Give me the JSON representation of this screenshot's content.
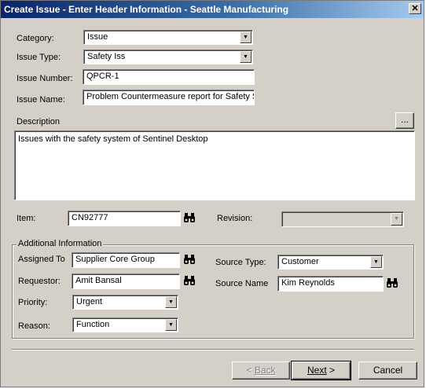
{
  "window": {
    "title": "Create Issue - Enter Header Information - Seattle Manufacturing",
    "close_glyph": "✕"
  },
  "form": {
    "category": {
      "label": "Category:",
      "value": "Issue"
    },
    "issue_type": {
      "label": "Issue Type:",
      "value": "Safety Iss"
    },
    "issue_number": {
      "label": "Issue Number:",
      "value": "QPCR-1"
    },
    "issue_name": {
      "label": "Issue Name:",
      "value": "Problem Countermeasure report for Safety Sy"
    },
    "description": {
      "label": "Description",
      "button": "...",
      "value": "Issues with the safety system of Sentinel Desktop"
    },
    "item": {
      "label": "Item:",
      "value": "CN92777"
    },
    "revision": {
      "label": "Revision:",
      "value": ""
    }
  },
  "additional": {
    "legend": "Additional Information",
    "assigned_to": {
      "label": "Assigned To",
      "value": "Supplier Core Group"
    },
    "requestor": {
      "label": "Requestor:",
      "value": "Amit Bansal"
    },
    "priority": {
      "label": "Priority:",
      "value": "Urgent"
    },
    "reason": {
      "label": "Reason:",
      "value": "Function"
    },
    "source_type": {
      "label": "Source Type:",
      "value": "Customer"
    },
    "source_name": {
      "label": "Source Name",
      "value": "Kim Reynolds"
    }
  },
  "buttons": {
    "back": {
      "arrow": "< ",
      "text": "Back",
      "enabled": false
    },
    "next": {
      "text": "Next",
      "arrow": " >",
      "enabled": true
    },
    "cancel": {
      "text": "Cancel"
    }
  }
}
